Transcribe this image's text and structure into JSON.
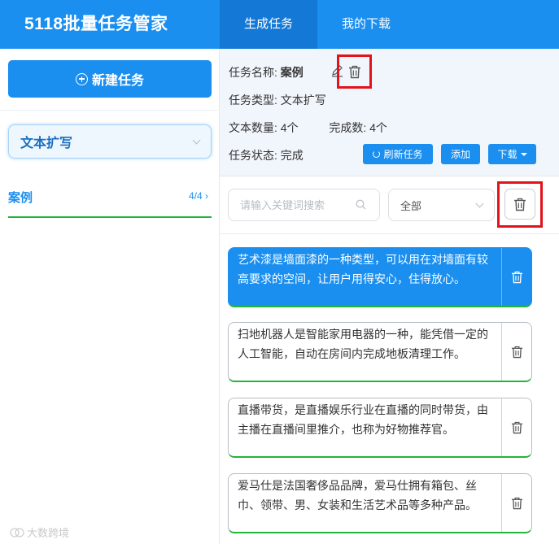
{
  "app": {
    "title": "5118批量任务管家"
  },
  "nav": {
    "tabs": [
      {
        "label": "生成任务"
      },
      {
        "label": "我的下载"
      }
    ]
  },
  "sidebar": {
    "new_task_label": "新建任务",
    "type_select_value": "文本扩写",
    "tasks": [
      {
        "name": "案例",
        "count": "4/4"
      }
    ]
  },
  "task_info": {
    "name_label": "任务名称:",
    "name_value": "案例",
    "type_label": "任务类型:",
    "type_value": "文本扩写",
    "count_label": "文本数量:",
    "count_value": "4个",
    "done_label": "完成数:",
    "done_value": "4个",
    "status_label": "任务状态:",
    "status_value": "完成"
  },
  "buttons": {
    "refresh": "刷新任务",
    "add": "添加",
    "download": "下载"
  },
  "filter": {
    "search_placeholder": "请输入关键词搜索",
    "status_value": "全部"
  },
  "texts": [
    {
      "content": "艺术漆是墙面漆的一种类型，可以用在对墙面有较高要求的空间，让用户用得安心，住得放心。"
    },
    {
      "content": "扫地机器人是智能家用电器的一种，能凭借一定的人工智能，自动在房间内完成地板清理工作。"
    },
    {
      "content": "直播带货，是直播娱乐行业在直播的同时带货，由主播在直播间里推介，也称为好物推荐官。"
    },
    {
      "content": "爱马仕是法国奢侈品品牌，爱马仕拥有箱包、丝巾、领带、男、女装和生活艺术品等多种产品。"
    }
  ],
  "watermark": "大数跨境",
  "colors": {
    "brand": "#1a8ff0",
    "success": "#26b33a",
    "highlight": "#e2131b"
  }
}
